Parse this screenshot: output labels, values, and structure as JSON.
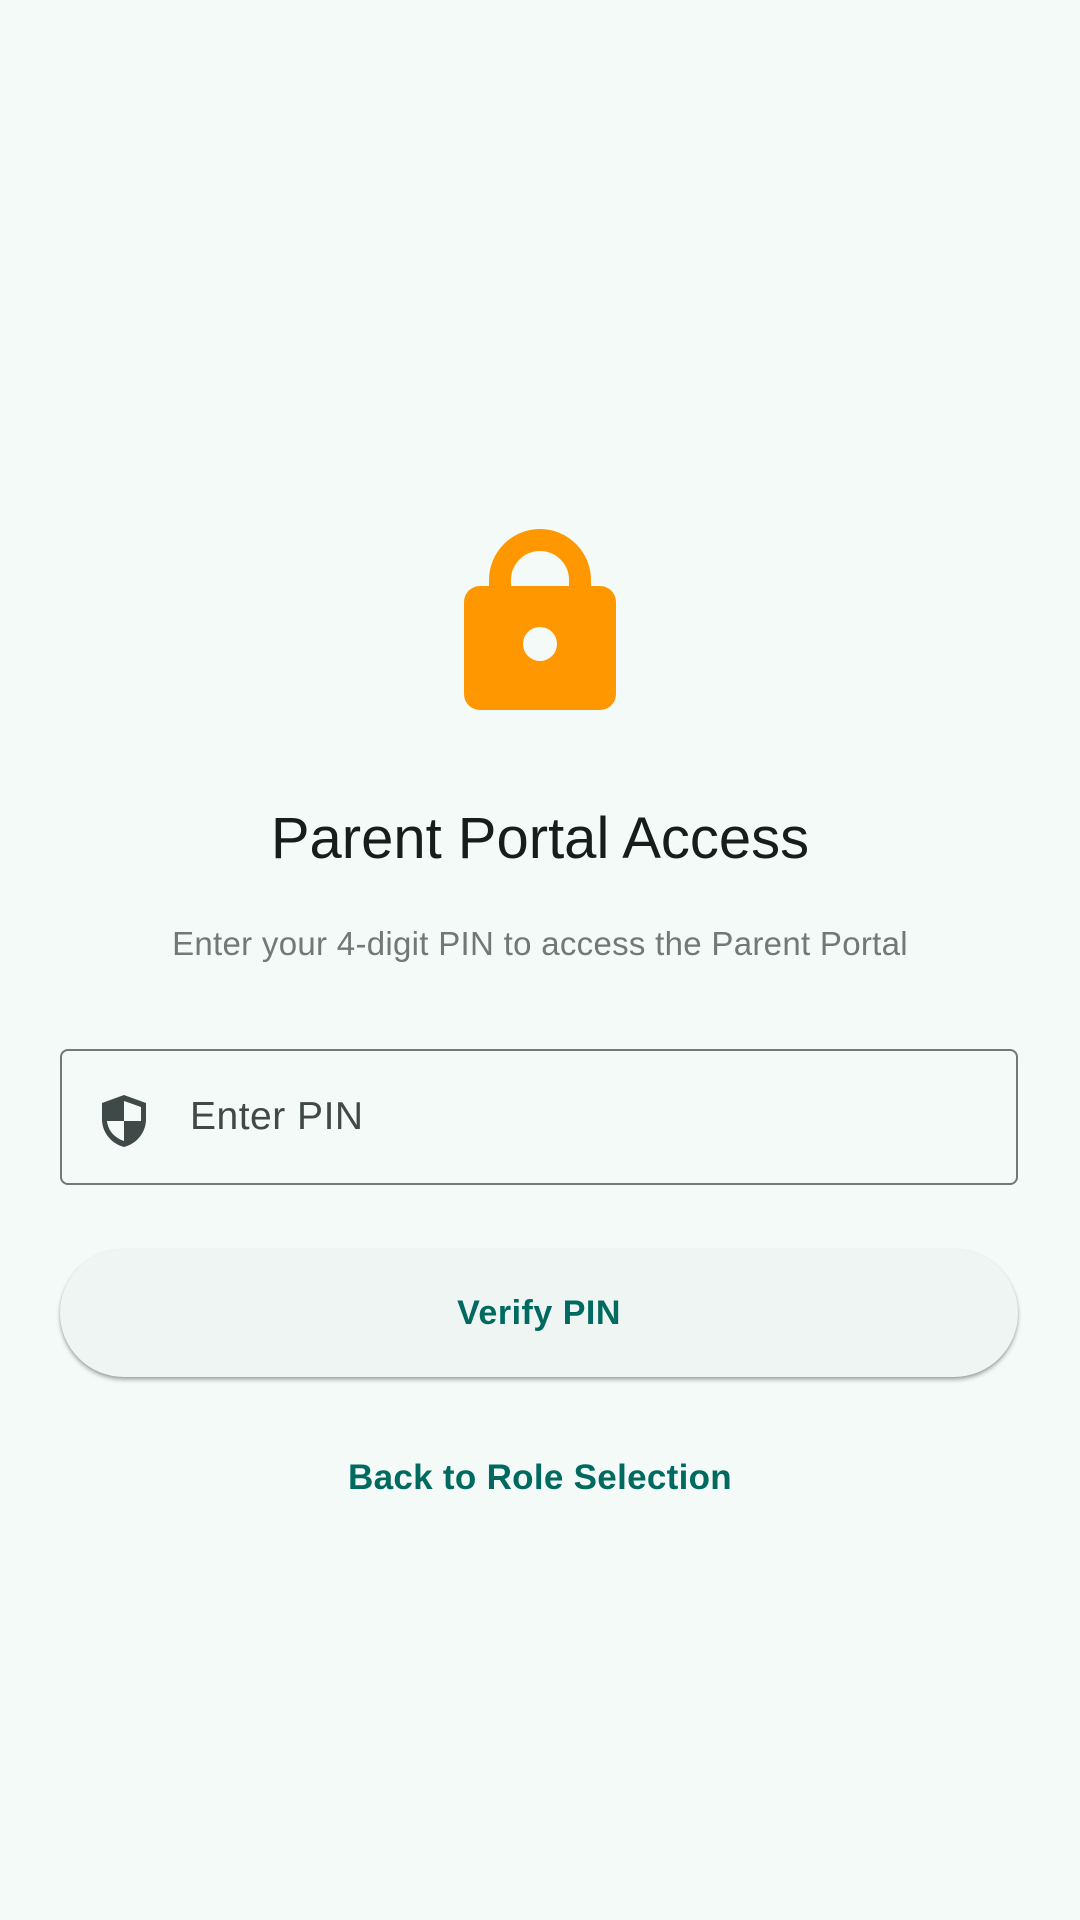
{
  "icons": {
    "lock": "lock-icon",
    "shield": "shield-icon"
  },
  "colors": {
    "background": "#f4faf8",
    "lock": "#ff9800",
    "accent": "#006a60",
    "title": "#171d1b",
    "subtitle": "#737877",
    "button_bg": "#eef5f2"
  },
  "header": {
    "title": "Parent Portal Access",
    "subtitle": "Enter your 4-digit PIN to access the Parent Portal"
  },
  "pin_field": {
    "placeholder": "Enter PIN",
    "value": ""
  },
  "actions": {
    "verify_label": "Verify PIN",
    "back_label": "Back to Role Selection"
  }
}
